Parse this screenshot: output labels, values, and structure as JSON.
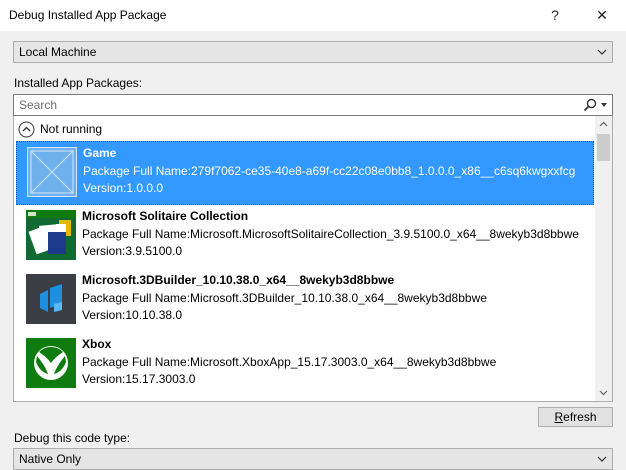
{
  "window": {
    "title": "Debug Installed App Package",
    "help_glyph": "?",
    "close_glyph": "✕"
  },
  "target": {
    "selected": "Local Machine"
  },
  "packages_label": "Installed App Packages:",
  "search": {
    "placeholder": "Search"
  },
  "group": {
    "label": "Not running"
  },
  "packages": [
    {
      "name": "Game",
      "full_name": "Package Full Name:279f7062-ce35-40e8-a69f-cc22c08e0bb8_1.0.0.0_x86__c6sq6kwgxxfcg",
      "version": "Version:1.0.0.0",
      "icon": "placeholder-icon"
    },
    {
      "name": "Microsoft Solitaire Collection",
      "full_name": "Package Full Name:Microsoft.MicrosoftSolitaireCollection_3.9.5100.0_x64__8wekyb3d8bbwe",
      "version": "Version:3.9.5100.0",
      "icon": "solitaire-icon"
    },
    {
      "name": "Microsoft.3DBuilder_10.10.38.0_x64__8wekyb3d8bbwe",
      "full_name": "Package Full Name:Microsoft.3DBuilder_10.10.38.0_x64__8wekyb3d8bbwe",
      "version": "Version:10.10.38.0",
      "icon": "3dbuilder-icon"
    },
    {
      "name": "Xbox",
      "full_name": "Package Full Name:Microsoft.XboxApp_15.17.3003.0_x64__8wekyb3d8bbwe",
      "version": "Version:15.17.3003.0",
      "icon": "xbox-icon"
    }
  ],
  "refresh_button": {
    "underlined": "R",
    "rest": "efresh"
  },
  "code_type": {
    "label": "Debug this code type:",
    "selected": "Native Only"
  },
  "colors": {
    "selection": "#3399ff",
    "xbox_green": "#107c10",
    "solitaire_green": "#0f6b32",
    "builder_bg": "#3b3f45"
  }
}
